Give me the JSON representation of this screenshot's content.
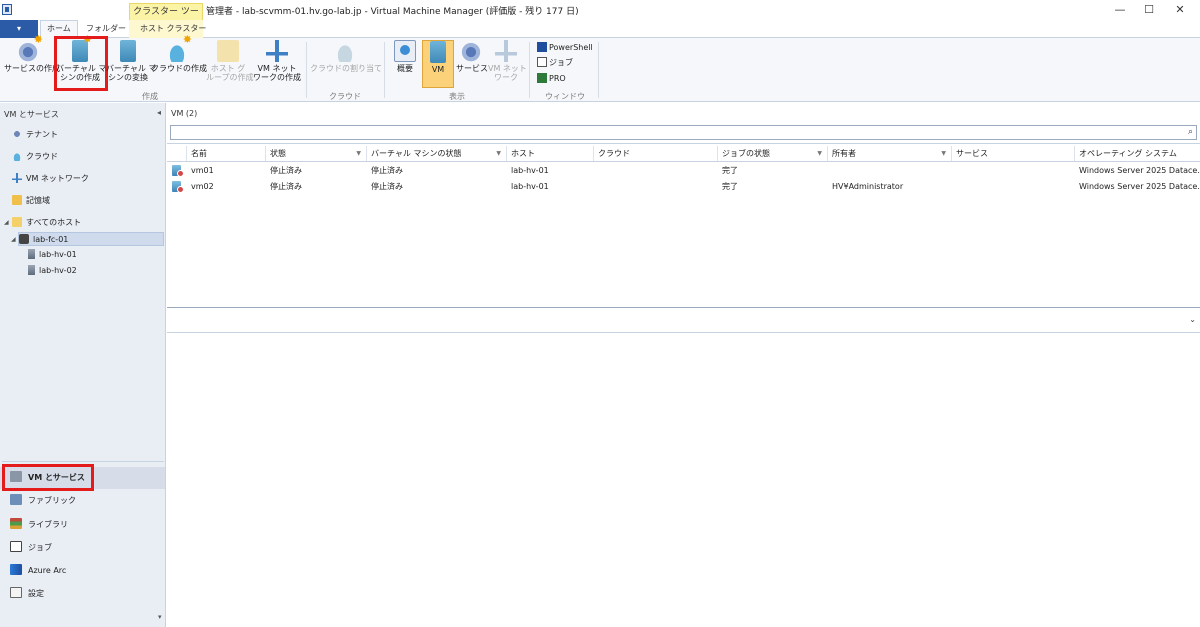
{
  "window": {
    "title": "管理者 - lab-scvmm-01.hv.go-lab.jp - Virtual Machine Manager (評価版 - 残り 177 日)",
    "context_tab_header": "クラスター ツール",
    "minimize_glyph": "—",
    "maximize_glyph": "☐",
    "close_glyph": "✕"
  },
  "ribbon_tabs": {
    "file_glyph": "▾",
    "home": "ホーム",
    "folder": "フォルダー",
    "host_cluster": "ホスト クラスター"
  },
  "ribbon": {
    "create_group": {
      "label": "作成",
      "create_service": "サービスの作成",
      "create_vm_l1": "バーチャル マ",
      "create_vm_l2": "シンの作成",
      "convert_vm_l1": "バーチャル マ",
      "convert_vm_l2": "シンの変換",
      "create_cloud": "クラウドの作成",
      "create_host_group_l1": "ホスト グ",
      "create_host_group_l2": "ループの作成",
      "create_vm_network_l1": "VM ネット",
      "create_vm_network_l2": "ワークの作成"
    },
    "cloud_group": {
      "label": "クラウド",
      "assign_cloud": "クラウドの割り当て"
    },
    "show_group": {
      "label": "表示",
      "overview": "概要",
      "vm": "VM",
      "services": "サービス",
      "vm_network_l1": "VM ネット",
      "vm_network_l2": "ワーク"
    },
    "window_group": {
      "label": "ウィンドウ",
      "powershell": "PowerShell",
      "jobs": "ジョブ",
      "pro": "PRO"
    }
  },
  "left_pane": {
    "header": "VM とサービス",
    "collapse_glyph": "◂",
    "items": {
      "tenant": "テナント",
      "cloud": "クラウド",
      "vm_network": "VM ネットワーク",
      "storage": "記憶域",
      "all_hosts": "すべてのホスト",
      "cluster": "lab-fc-01",
      "host1": "lab-hv-01",
      "host2": "lab-hv-02"
    },
    "workspaces": {
      "vms_services": "VM とサービス",
      "fabric": "ファブリック",
      "library": "ライブラリ",
      "jobs": "ジョブ",
      "azure_arc": "Azure Arc",
      "settings": "設定"
    },
    "scroll_down_glyph": "▾"
  },
  "main": {
    "header": "VM (2)",
    "search_value": "",
    "search_glyph": "⌕",
    "columns": [
      "名前",
      "状態",
      "バーチャル マシンの状態",
      "ホスト",
      "クラウド",
      "ジョブの状態",
      "所有者",
      "サービス",
      "オペレーティング システム"
    ],
    "filter_glyph": "▼",
    "rows": [
      [
        "vm01",
        "停止済み",
        "停止済み",
        "lab-hv-01",
        "",
        "完了",
        "",
        "",
        "Windows Server 2025 Datace..."
      ],
      [
        "vm02",
        "停止済み",
        "停止済み",
        "lab-hv-01",
        "",
        "完了",
        "HV¥Administrator",
        "",
        "Windows Server 2025 Datace..."
      ]
    ],
    "detail_chevron": "⌄"
  },
  "colors": {
    "file_tab": "#2b5aa6",
    "context_tab": "#fbf3a6",
    "highlight_box": "#e31b1b",
    "active_button": "#fbd27a"
  },
  "icons": {
    "service": "gear-icon",
    "vm": "server-icon",
    "cloud": "cloud-icon",
    "network": "network-icon",
    "folder": "folder-icon"
  }
}
